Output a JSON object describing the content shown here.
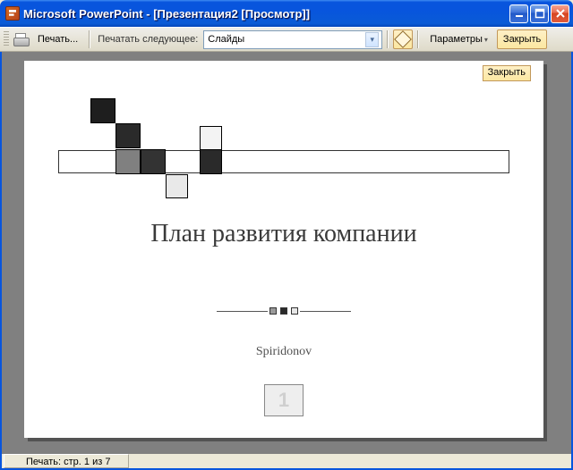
{
  "titlebar": {
    "app_name": "Microsoft PowerPoint",
    "doc_title": "[Презентация2 [Просмотр]]"
  },
  "toolbar": {
    "print_label": "Печать...",
    "print_what_label": "Печатать следующее:",
    "dropdown_value": "Слайды",
    "options_label": "Параметры",
    "close_label": "Закрыть"
  },
  "slide": {
    "inpage_close": "Закрыть",
    "title": "План развития компании",
    "author": "Spiridonov",
    "page_number": "1"
  },
  "statusbar": {
    "text": "Печать: стр. 1 из 7"
  },
  "icons": {
    "minimize": "minimize-icon",
    "maximize": "maximize-icon",
    "close": "close-icon"
  }
}
